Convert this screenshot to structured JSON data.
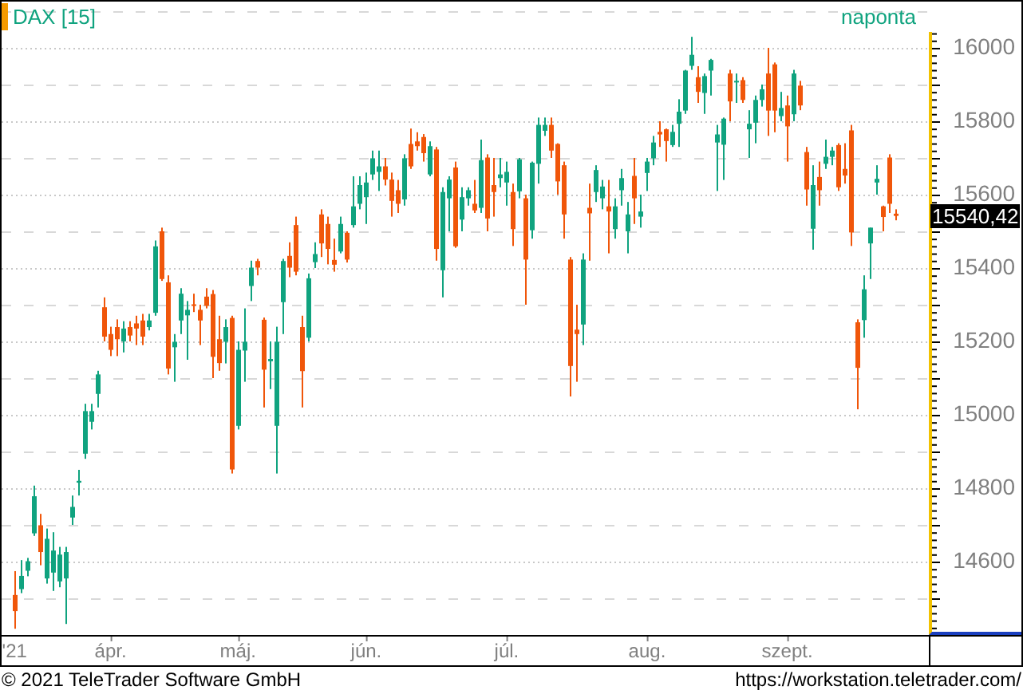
{
  "header": {
    "symbol": "DAX [15]",
    "interval": "naponta"
  },
  "chart": {
    "last_price": "15540,42",
    "chart_data": {
      "type": "candlestick",
      "grid": true,
      "ylim": [
        14400,
        16126
      ],
      "yticks": [
        {
          "value": 14600,
          "label": "14600"
        },
        {
          "value": 14800,
          "label": "14800"
        },
        {
          "value": 15000,
          "label": "15000"
        },
        {
          "value": 15200,
          "label": "15200"
        },
        {
          "value": 15400,
          "label": "15400"
        },
        {
          "value": 15600,
          "label": "15600"
        },
        {
          "value": 15800,
          "label": "15800"
        },
        {
          "value": 16000,
          "label": "16000"
        }
      ],
      "categories": [
        "'21",
        null,
        null,
        null,
        null,
        null,
        null,
        null,
        null,
        null,
        null,
        null,
        null,
        null,
        null,
        "ápr.",
        null,
        null,
        null,
        null,
        null,
        null,
        null,
        null,
        null,
        null,
        null,
        null,
        null,
        null,
        null,
        null,
        null,
        null,
        null,
        "máj.",
        null,
        null,
        null,
        null,
        null,
        null,
        null,
        null,
        null,
        null,
        null,
        null,
        null,
        null,
        null,
        null,
        null,
        null,
        null,
        "jún.",
        null,
        null,
        null,
        null,
        null,
        null,
        null,
        null,
        null,
        null,
        null,
        null,
        null,
        null,
        null,
        null,
        null,
        null,
        null,
        null,
        null,
        "júl.",
        null,
        null,
        null,
        null,
        null,
        null,
        null,
        null,
        null,
        null,
        null,
        null,
        null,
        null,
        null,
        null,
        null,
        null,
        null,
        null,
        null,
        "aug.",
        null,
        null,
        null,
        null,
        null,
        null,
        null,
        null,
        null,
        null,
        null,
        null,
        null,
        null,
        null,
        null,
        null,
        null,
        null,
        null,
        null,
        "szept.",
        null,
        null,
        null,
        null,
        null,
        null,
        null,
        null,
        null,
        null,
        null,
        null,
        null,
        null,
        null,
        null,
        null
      ],
      "ohlc": [
        [
          14509,
          14574,
          14417,
          14465
        ],
        [
          14525,
          14604,
          14514,
          14561
        ],
        [
          14575,
          14610,
          14560,
          14601
        ],
        [
          14677,
          14807,
          14670,
          14778
        ],
        [
          14699,
          14730,
          14590,
          14626
        ],
        [
          14554,
          14690,
          14540,
          14662
        ],
        [
          14570,
          14680,
          14520,
          14630
        ],
        [
          14546,
          14640,
          14530,
          14619
        ],
        [
          14554,
          14640,
          14430,
          14626
        ],
        [
          14720,
          14780,
          14700,
          14749
        ],
        [
          14815,
          14850,
          14780,
          14820
        ],
        [
          14894,
          15030,
          14880,
          15010
        ],
        [
          14981,
          15030,
          14960,
          15010
        ],
        [
          15057,
          15120,
          15020,
          15110
        ],
        [
          15293,
          15320,
          15200,
          15213
        ],
        [
          15220,
          15240,
          15160,
          15177
        ],
        [
          15239,
          15260,
          15160,
          15206
        ],
        [
          15200,
          15255,
          15170,
          15235
        ],
        [
          15239,
          15255,
          15200,
          15216
        ],
        [
          15249,
          15270,
          15190,
          15235
        ],
        [
          15257,
          15275,
          15190,
          15213
        ],
        [
          15239,
          15275,
          15230,
          15257
        ],
        [
          15278,
          15475,
          15270,
          15459
        ],
        [
          15500,
          15510,
          15365,
          15370
        ],
        [
          15361,
          15380,
          15110,
          15126
        ],
        [
          15184,
          15220,
          15090,
          15199
        ],
        [
          15257,
          15345,
          15220,
          15330
        ],
        [
          15271,
          15310,
          15150,
          15286
        ],
        [
          15301,
          15330,
          15280,
          15297
        ],
        [
          15286,
          15300,
          15190,
          15257
        ],
        [
          15322,
          15345,
          15290,
          15297
        ],
        [
          15329,
          15340,
          15100,
          15158
        ],
        [
          15206,
          15270,
          15120,
          15141
        ],
        [
          15199,
          15260,
          15140,
          15239
        ],
        [
          15264,
          15270,
          14840,
          14851
        ],
        [
          14970,
          15200,
          14960,
          15177
        ],
        [
          15175,
          15290,
          15090,
          15199
        ],
        [
          15351,
          15420,
          15310,
          15401
        ],
        [
          15419,
          15425,
          15380,
          15401
        ],
        [
          15259,
          15265,
          15020,
          15123
        ],
        [
          15146,
          15200,
          15070,
          15152
        ],
        [
          14970,
          15240,
          14840,
          15199
        ],
        [
          15307,
          15425,
          15220,
          15419
        ],
        [
          15433,
          15470,
          15375,
          15401
        ],
        [
          15517,
          15540,
          15380,
          15390
        ],
        [
          15239,
          15270,
          15020,
          15119
        ],
        [
          15210,
          15385,
          15200,
          15372
        ],
        [
          15416,
          15470,
          15400,
          15438
        ],
        [
          15546,
          15560,
          15430,
          15467
        ],
        [
          15520,
          15540,
          15410,
          15452
        ],
        [
          15422,
          15480,
          15390,
          15409
        ],
        [
          15445,
          15540,
          15440,
          15520
        ],
        [
          15496,
          15500,
          15415,
          15423
        ],
        [
          15517,
          15650,
          15510,
          15568
        ],
        [
          15575,
          15650,
          15560,
          15626
        ],
        [
          15593,
          15660,
          15520,
          15633
        ],
        [
          15655,
          15720,
          15640,
          15699
        ],
        [
          15662,
          15720,
          15610,
          15677
        ],
        [
          15677,
          15700,
          15625,
          15641
        ],
        [
          15641,
          15660,
          15540,
          15583
        ],
        [
          15612,
          15640,
          15550,
          15575
        ],
        [
          15587,
          15710,
          15570,
          15699
        ],
        [
          15738,
          15780,
          15670,
          15677
        ],
        [
          15745,
          15770,
          15720,
          15732
        ],
        [
          15757,
          15765,
          15690,
          15713
        ],
        [
          15655,
          15745,
          15650,
          15732
        ],
        [
          15723,
          15730,
          15420,
          15452
        ],
        [
          15394,
          15620,
          15320,
          15607
        ],
        [
          15590,
          15650,
          15500,
          15641
        ],
        [
          15674,
          15690,
          15455,
          15459
        ],
        [
          15532,
          15620,
          15500,
          15593
        ],
        [
          15590,
          15620,
          15570,
          15612
        ],
        [
          15575,
          15640,
          15550,
          15557
        ],
        [
          15564,
          15750,
          15550,
          15694
        ],
        [
          15701,
          15710,
          15500,
          15535
        ],
        [
          15626,
          15700,
          15540,
          15607
        ],
        [
          15645,
          15700,
          15620,
          15655
        ],
        [
          15633,
          15690,
          15570,
          15662
        ],
        [
          15607,
          15630,
          15460,
          15506
        ],
        [
          15609,
          15700,
          15590,
          15696
        ],
        [
          15590,
          15600,
          15300,
          15423
        ],
        [
          15503,
          15690,
          15480,
          15687
        ],
        [
          15684,
          15810,
          15630,
          15790
        ],
        [
          15774,
          15810,
          15760,
          15790
        ],
        [
          15790,
          15810,
          15700,
          15720
        ],
        [
          15738,
          15740,
          15600,
          15636
        ],
        [
          15680,
          15690,
          15480,
          15546
        ],
        [
          15423,
          15430,
          15050,
          15133
        ],
        [
          15232,
          15300,
          15090,
          15220
        ],
        [
          15246,
          15440,
          15190,
          15423
        ],
        [
          15564,
          15630,
          15420,
          15549
        ],
        [
          15607,
          15680,
          15580,
          15667
        ],
        [
          15590,
          15640,
          15560,
          15622
        ],
        [
          15568,
          15640,
          15440,
          15554
        ],
        [
          15506,
          15590,
          15480,
          15568
        ],
        [
          15612,
          15670,
          15570,
          15645
        ],
        [
          15500,
          15580,
          15440,
          15546
        ],
        [
          15651,
          15700,
          15520,
          15590
        ],
        [
          15540,
          15600,
          15510,
          15554
        ],
        [
          15659,
          15700,
          15610,
          15690
        ],
        [
          15699,
          15760,
          15680,
          15742
        ],
        [
          15771,
          15800,
          15730,
          15764
        ],
        [
          15778,
          15780,
          15690,
          15746
        ],
        [
          15735,
          15790,
          15730,
          15771
        ],
        [
          15793,
          15860,
          15730,
          15826
        ],
        [
          15829,
          15940,
          15820,
          15938
        ],
        [
          15951,
          16030,
          15940,
          15981
        ],
        [
          15920,
          15950,
          15850,
          15880
        ],
        [
          15877,
          15930,
          15820,
          15923
        ],
        [
          15938,
          15970,
          15870,
          15967
        ],
        [
          15742,
          15790,
          15610,
          15764
        ],
        [
          15736,
          15810,
          15640,
          15807
        ],
        [
          15930,
          15940,
          15800,
          15854
        ],
        [
          15906,
          15930,
          15850,
          15910
        ],
        [
          15912,
          15920,
          15850,
          15858
        ],
        [
          15778,
          15830,
          15700,
          15793
        ],
        [
          15796,
          15870,
          15740,
          15858
        ],
        [
          15858,
          15900,
          15840,
          15887
        ],
        [
          15930,
          16000,
          15760,
          15829
        ],
        [
          15955,
          15960,
          15770,
          15829
        ],
        [
          15814,
          15880,
          15800,
          15836
        ],
        [
          15843,
          15870,
          15690,
          15786
        ],
        [
          15819,
          15940,
          15800,
          15930
        ],
        [
          15897,
          15910,
          15830,
          15843
        ],
        [
          15716,
          15730,
          15570,
          15614
        ],
        [
          15507,
          15680,
          15450,
          15626
        ],
        [
          15648,
          15690,
          15570,
          15612
        ],
        [
          15684,
          15750,
          15670,
          15703
        ],
        [
          15703,
          15730,
          15680,
          15720
        ],
        [
          15735,
          15740,
          15610,
          15620
        ],
        [
          15670,
          15740,
          15630,
          15652
        ],
        [
          15775,
          15790,
          15460,
          15497
        ],
        [
          15252,
          15260,
          15015,
          15128
        ],
        [
          15258,
          15380,
          15210,
          15342
        ],
        [
          15467,
          15510,
          15370,
          15510
        ],
        [
          15633,
          15680,
          15600,
          15643
        ],
        [
          15568,
          15570,
          15500,
          15539
        ],
        [
          15701,
          15710,
          15550,
          15575
        ],
        [
          15548,
          15560,
          15530,
          15542
        ]
      ]
    }
  },
  "footer": {
    "copyright": "© 2021 TeleTrader Software GmbH",
    "url": "https://workstation.teletrader.com/"
  }
}
